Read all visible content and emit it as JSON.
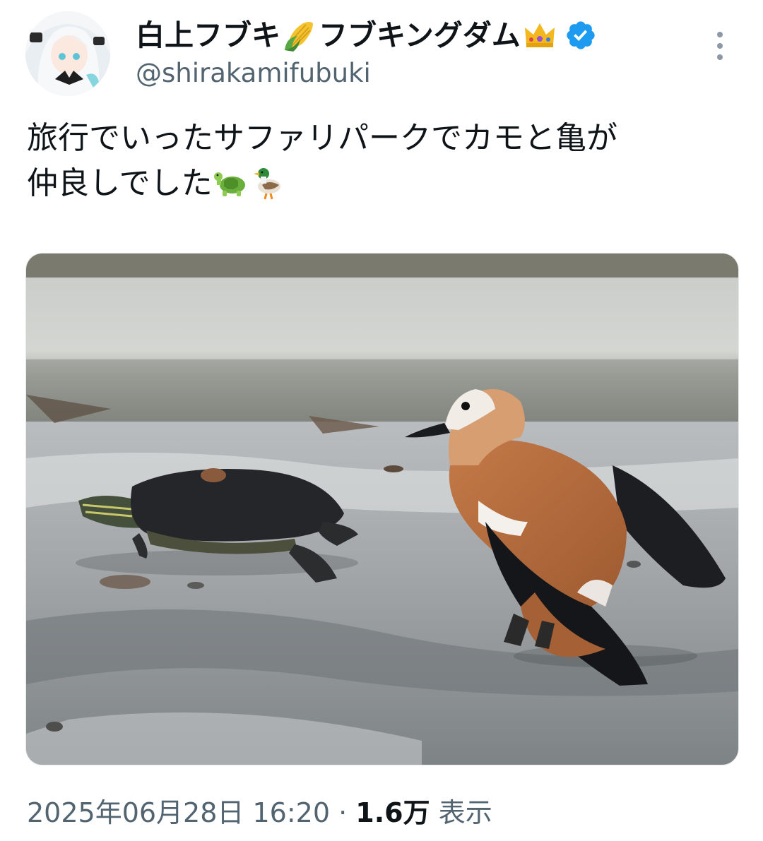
{
  "author": {
    "display_name": "白上フブキ",
    "display_name_2": "フブキングダム",
    "name_emojis": [
      "corn-emoji",
      "crown-emoji"
    ],
    "verified_icon": "verified-badge-icon",
    "handle": "@shirakamifubuki",
    "avatar": "avatar-image"
  },
  "menu_icon": "more-options-icon",
  "tweet": {
    "line1": "旅行でいったサファリパークでカモと亀が",
    "line2": "仲良しでした",
    "line2_emojis": [
      "turtle-emoji",
      "duck-emoji"
    ]
  },
  "media": {
    "photo": "turtle-and-duck-photo"
  },
  "meta": {
    "timestamp": "2025年06月28日 16:20",
    "separator": "·",
    "views_count": "1.6万",
    "views_label": "表示"
  },
  "colors": {
    "text": "#0f1419",
    "secondary": "#536471",
    "verified": "#1d9bf0"
  }
}
